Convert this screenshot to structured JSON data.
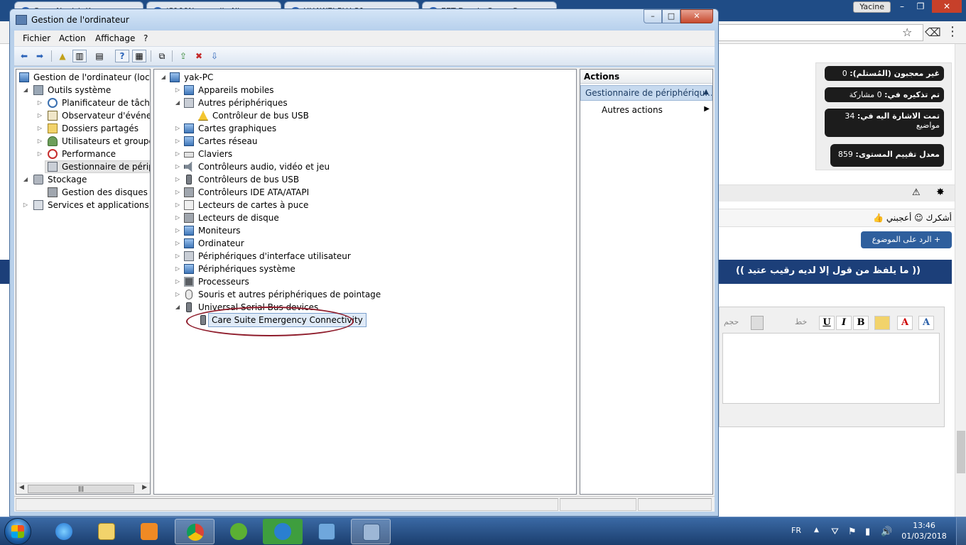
{
  "browser": {
    "tabs": [
      {
        "label": "C...  ...Nanish Kr..."
      },
      {
        "label": "(S100N... ...ssile Nie..."
      },
      {
        "label": "HUAWEI PLU-21 ..."
      },
      {
        "label": "EET Dessin Cen... Cr..."
      }
    ],
    "user": "Yacine",
    "min": "–",
    "restore": "❐",
    "close": "✕"
  },
  "forum": {
    "stats": [
      {
        "label": "غير معجبون (المُستلم):",
        "value": "0"
      },
      {
        "label": "تم تذكيره في:",
        "value": "0 مشاركة"
      },
      {
        "label": "تمت الاشارة اليه في:",
        "value": "34 مواضيع"
      },
      {
        "label": "معدل تقييم المستوى:",
        "value": "859"
      }
    ],
    "thanks_text": "أشكرك ☺ أعجبني 👍",
    "reply_button": "+ الرد على الموضوع",
    "quote": "(( ما يلفظ من قول إلا لديه رقيب عتيد ))",
    "editor_font_label": "خط",
    "editor_size_label": "حجم"
  },
  "mmc": {
    "title": "Gestion de l'ordinateur",
    "window_buttons": {
      "min": "–",
      "max": "□",
      "close": "✕"
    },
    "menu": [
      "Fichier",
      "Action",
      "Affichage",
      "?"
    ],
    "tree": {
      "root": "Gestion de l'ordinateur (local)",
      "system_tools": "Outils système",
      "items": [
        "Planificateur de tâches",
        "Observateur d'événeme",
        "Dossiers partagés",
        "Utilisateurs et groupes l",
        "Performance",
        "Gestionnaire de périphé"
      ],
      "storage": "Stockage",
      "disk_mgmt": "Gestion des disques",
      "services": "Services et applications"
    },
    "devices": {
      "computer": "yak-PC",
      "categories": [
        "Appareils mobiles",
        "Autres périphériques",
        "Contrôleur de bus USB",
        "Cartes graphiques",
        "Cartes réseau",
        "Claviers",
        "Contrôleurs audio, vidéo et jeu",
        "Contrôleurs de bus USB",
        "Contrôleurs IDE ATA/ATAPI",
        "Lecteurs de cartes à puce",
        "Lecteurs de disque",
        "Moniteurs",
        "Ordinateur",
        "Périphériques d'interface utilisateur",
        "Périphériques système",
        "Processeurs",
        "Souris et autres périphériques de pointage",
        "Universal Serial Bus devices"
      ],
      "selected": "Care Suite Emergency Connectivity"
    },
    "actions": {
      "header": "Actions",
      "section": "Gestionnaire de périphériqu...",
      "more": "Autres actions"
    }
  },
  "taskbar": {
    "lang": "FR",
    "time": "13:46",
    "date": "01/03/2018"
  }
}
